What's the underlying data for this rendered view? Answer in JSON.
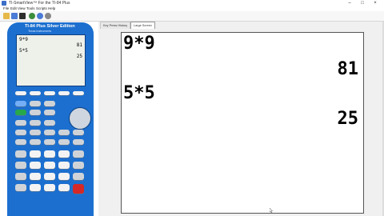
{
  "window": {
    "title": "TI-SmartView™ For the TI-84 Plus",
    "minimize": "–",
    "maximize": "□",
    "close": "×"
  },
  "menu": [
    "File",
    "Edit",
    "View",
    "Tools",
    "Scripts",
    "Help"
  ],
  "toolbar": {
    "icons": [
      "open-icon",
      "save-icon",
      "calculator-icon",
      "screenshot-icon",
      "keypress-icon",
      "capture-icon"
    ]
  },
  "calculator": {
    "model": "TI-84 Plus Silver Edition",
    "brand": "Texas Instruments",
    "screen": [
      {
        "input": "9*9",
        "result": "81"
      },
      {
        "input": "5*5",
        "result": "25"
      }
    ]
  },
  "tabs": [
    "Key Press History",
    "Large Screen"
  ],
  "large_screen": {
    "lines": [
      {
        "input": "9*9",
        "result": "81"
      },
      {
        "input": "5*5",
        "result": "25"
      }
    ]
  },
  "colors": {
    "calc_blue": "#1c6fcf",
    "key_green": "#27a84a",
    "key_red": "#d42828"
  }
}
